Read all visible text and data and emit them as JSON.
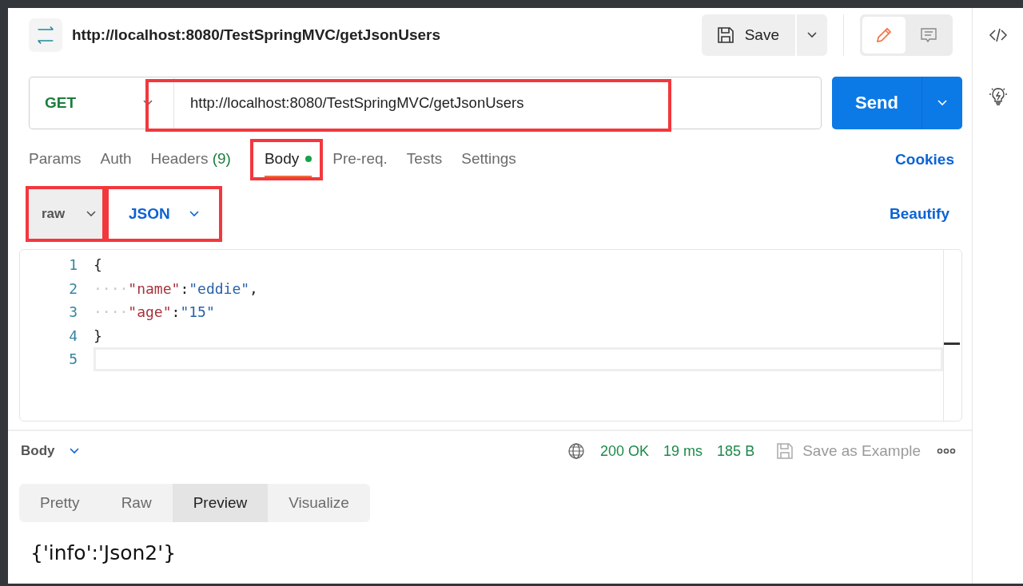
{
  "request": {
    "title": "http://localhost:8080/TestSpringMVC/getJsonUsers"
  },
  "toolbar": {
    "save_label": "Save",
    "modes": [
      {
        "kind": "edit",
        "selected": true
      },
      {
        "kind": "comment",
        "selected": false
      }
    ]
  },
  "url_bar": {
    "method": "GET",
    "url": "http://localhost:8080/TestSpringMVC/getJsonUsers",
    "highlighted": true,
    "send_label": "Send"
  },
  "tabs": [
    {
      "label": "Params",
      "selected": false,
      "highlighted": false
    },
    {
      "label": "Auth",
      "selected": false,
      "highlighted": false
    },
    {
      "label": "Headers",
      "count": "(9)",
      "selected": false,
      "highlighted": false
    },
    {
      "label": "Body",
      "dot": true,
      "selected": true,
      "highlighted": true
    },
    {
      "label": "Pre-req.",
      "selected": false,
      "highlighted": false
    },
    {
      "label": "Tests",
      "selected": false,
      "highlighted": false
    },
    {
      "label": "Settings",
      "selected": false,
      "highlighted": false
    }
  ],
  "cookies_link": "Cookies",
  "body_options": {
    "mode": {
      "label": "raw",
      "highlighted": true
    },
    "format": {
      "label": "JSON",
      "highlighted": true
    },
    "beautify": "Beautify"
  },
  "editor": {
    "lines": [
      {
        "number": "1",
        "tokens": [
          {
            "kind": "punct",
            "text": "{"
          }
        ]
      },
      {
        "number": "2",
        "tokens": [
          {
            "kind": "space",
            "text": "····"
          },
          {
            "kind": "key",
            "text": "\"name\""
          },
          {
            "kind": "punct",
            "text": ":"
          },
          {
            "kind": "string",
            "text": "\"eddie\""
          },
          {
            "kind": "punct",
            "text": ","
          }
        ]
      },
      {
        "number": "3",
        "tokens": [
          {
            "kind": "space",
            "text": "····"
          },
          {
            "kind": "key",
            "text": "\"age\""
          },
          {
            "kind": "punct",
            "text": ":"
          },
          {
            "kind": "string",
            "text": "\"15\""
          }
        ]
      },
      {
        "number": "4",
        "tokens": [
          {
            "kind": "punct",
            "text": "}"
          }
        ]
      },
      {
        "number": "5",
        "current": true
      }
    ]
  },
  "response": {
    "section": "Body",
    "status": "200 OK",
    "time": "19 ms",
    "size": "185 B",
    "save_example": "Save as Example",
    "views": [
      {
        "label": "Pretty",
        "selected": false
      },
      {
        "label": "Raw",
        "selected": false
      },
      {
        "label": "Preview",
        "selected": true
      },
      {
        "label": "Visualize",
        "selected": false
      }
    ],
    "preview": "{'info':'Json2'}"
  }
}
